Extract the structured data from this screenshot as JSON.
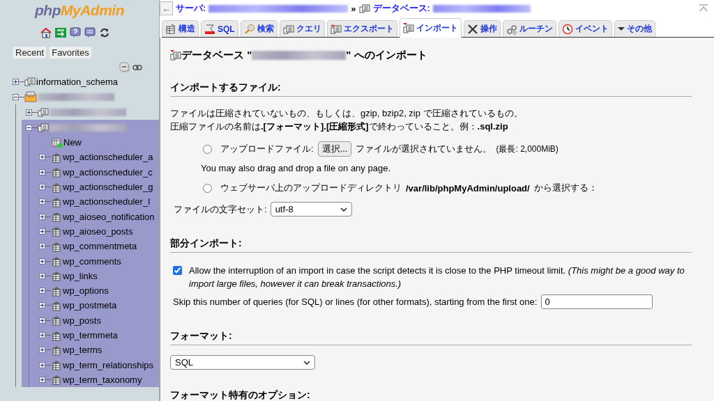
{
  "sidebar": {
    "logo": {
      "part_1": "php",
      "part_2": "MyAdmin"
    },
    "nav_buttons": [
      {
        "label": "Recent"
      },
      {
        "label": "Favorites"
      }
    ],
    "tree": [
      {
        "kind": "database",
        "label": "information_schema",
        "blurred": false,
        "expanded": false,
        "selected": false
      },
      {
        "kind": "server-db",
        "blurred": true,
        "expanded": true,
        "selected": false,
        "children": [
          {
            "kind": "database",
            "blurred": true,
            "expanded": false,
            "selected": false
          },
          {
            "kind": "database",
            "blurred": true,
            "expanded": true,
            "selected": true,
            "children": [
              {
                "kind": "new",
                "label": "New",
                "blurred": false,
                "selected": false
              },
              {
                "kind": "table",
                "label": "wp_actionscheduler_a",
                "blurred": false,
                "expanded": false,
                "selected": false
              },
              {
                "kind": "table",
                "label": "wp_actionscheduler_c",
                "blurred": false,
                "expanded": false,
                "selected": false
              },
              {
                "kind": "table",
                "label": "wp_actionscheduler_g",
                "blurred": false,
                "expanded": false,
                "selected": false
              },
              {
                "kind": "table",
                "label": "wp_actionscheduler_l",
                "blurred": false,
                "expanded": false,
                "selected": false
              },
              {
                "kind": "table",
                "label": "wp_aioseo_notification",
                "blurred": false,
                "expanded": false,
                "selected": false
              },
              {
                "kind": "table",
                "label": "wp_aioseo_posts",
                "blurred": false,
                "expanded": false,
                "selected": false
              },
              {
                "kind": "table",
                "label": "wp_commentmeta",
                "blurred": false,
                "expanded": false,
                "selected": false
              },
              {
                "kind": "table",
                "label": "wp_comments",
                "blurred": false,
                "expanded": false,
                "selected": false
              },
              {
                "kind": "table",
                "label": "wp_links",
                "blurred": false,
                "expanded": false,
                "selected": false
              },
              {
                "kind": "table",
                "label": "wp_options",
                "blurred": false,
                "expanded": false,
                "selected": false
              },
              {
                "kind": "table",
                "label": "wp_postmeta",
                "blurred": false,
                "expanded": false,
                "selected": false
              },
              {
                "kind": "table",
                "label": "wp_posts",
                "blurred": false,
                "expanded": false,
                "selected": false
              },
              {
                "kind": "table",
                "label": "wp_termmeta",
                "blurred": false,
                "expanded": false,
                "selected": false
              },
              {
                "kind": "table",
                "label": "wp_terms",
                "blurred": false,
                "expanded": false,
                "selected": false
              },
              {
                "kind": "table",
                "label": "wp_term_relationships",
                "blurred": false,
                "expanded": false,
                "selected": false
              },
              {
                "kind": "table",
                "label": "wp_term_taxonomy",
                "blurred": false,
                "expanded": false,
                "selected": false
              }
            ]
          }
        ]
      }
    ]
  },
  "breadcrumb": {
    "back": "←",
    "server_label": "サーバ:",
    "separator": "»",
    "database_label": "データベース:"
  },
  "tabs": [
    {
      "kind": "structure",
      "label": "構造",
      "selected": false
    },
    {
      "kind": "sql",
      "label": "SQL",
      "selected": false
    },
    {
      "kind": "search",
      "label": "検索",
      "selected": false
    },
    {
      "kind": "query",
      "label": "クエリ",
      "selected": false
    },
    {
      "kind": "export",
      "label": "エクスポート",
      "selected": false
    },
    {
      "kind": "import",
      "label": "インポート",
      "selected": true
    },
    {
      "kind": "operations",
      "label": "操作",
      "selected": false
    },
    {
      "kind": "routines",
      "label": "ルーチン",
      "selected": false
    },
    {
      "kind": "events",
      "label": "イベント",
      "selected": false
    },
    {
      "kind": "more",
      "label": "その他",
      "selected": false
    }
  ],
  "page": {
    "heading_prefix": "データベース \"",
    "heading_suffix": "\" へのインポート",
    "file_section": {
      "title": "インポートするファイル:",
      "description_1": "ファイルは圧縮されていないもの、もしくは、gzip, bzip2, zip で圧縮されているもの。",
      "description_2": "圧縮ファイルの名前は**.[フォーマット].[圧縮形式]**で終わっていること。例：**.sql.zip**",
      "upload": {
        "label": "アップロードファイル:",
        "selected": false,
        "button": "選択...",
        "status": "ファイルが選択されていません。",
        "max": "(最長: 2,000MiB)"
      },
      "drag_note": "You may also drag and drop a file on any page.",
      "server_dir": {
        "label": "ウェブサーバ上のアップロードディレクトリ",
        "path": "/var/lib/phpMyAdmin/upload/",
        "suffix": "から選択する：",
        "selected": false
      },
      "charset": {
        "label": "ファイルの文字セット:",
        "value": "utf-8"
      }
    },
    "partial_section": {
      "title": "部分インポート:",
      "allow_interrupt": {
        "checked": true,
        "text": "Allow the interruption of an import in case the script detects it is close to the PHP timeout limit. *(This might be a good way to import large files, however it can break transactions.)*"
      },
      "skip": {
        "label": "Skip this number of queries (for SQL) or lines (for other formats), starting from the first one:",
        "value": "0"
      }
    },
    "format_section": {
      "title": "フォーマット:",
      "value": "SQL"
    },
    "options_section": {
      "title": "フォーマット特有のオプション:"
    }
  }
}
